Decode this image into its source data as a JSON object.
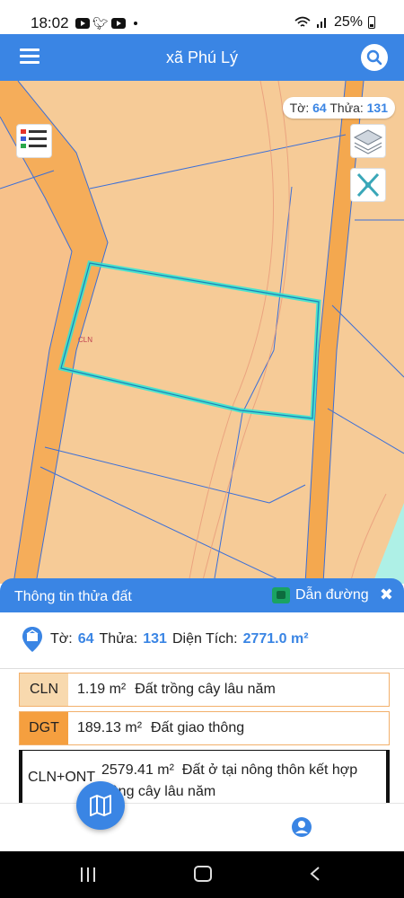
{
  "status_bar": {
    "time": "18:02",
    "battery": "25%"
  },
  "app_bar": {
    "title": "xã Phú Lý"
  },
  "map": {
    "badge_to_label": "Tờ:",
    "badge_to_value": "64",
    "badge_thua_label": "Thửa:",
    "badge_thua_value": "131",
    "small_label": "CLN"
  },
  "sheet": {
    "title": "Thông tin thửa đất",
    "directions_label": "Dẫn đường",
    "summary": {
      "to_label": "Tờ:",
      "to_value": "64",
      "thua_label": "Thửa:",
      "thua_value": "131",
      "area_label": "Diện Tích:",
      "area_value": "2771.0 m²"
    },
    "rows": [
      {
        "code": "CLN",
        "area": "1.19 m²",
        "desc": "Đất trồng cây lâu năm",
        "color": "#f8d9ae"
      },
      {
        "code": "DGT",
        "area": "189.13 m²",
        "desc": "Đất giao thông",
        "color": "#f59f3f"
      },
      {
        "code": "CLN+ONT",
        "area": "2579.41 m²",
        "desc_line1": "Đất ở tại nông thôn kết hợp",
        "desc_line2": "trồng cây lâu năm"
      }
    ]
  },
  "colors": {
    "primary": "#3a85e4",
    "map_fill": "#f6cb97",
    "road": "#f4a84f",
    "parcel_highlight": "#2ee6d6"
  }
}
